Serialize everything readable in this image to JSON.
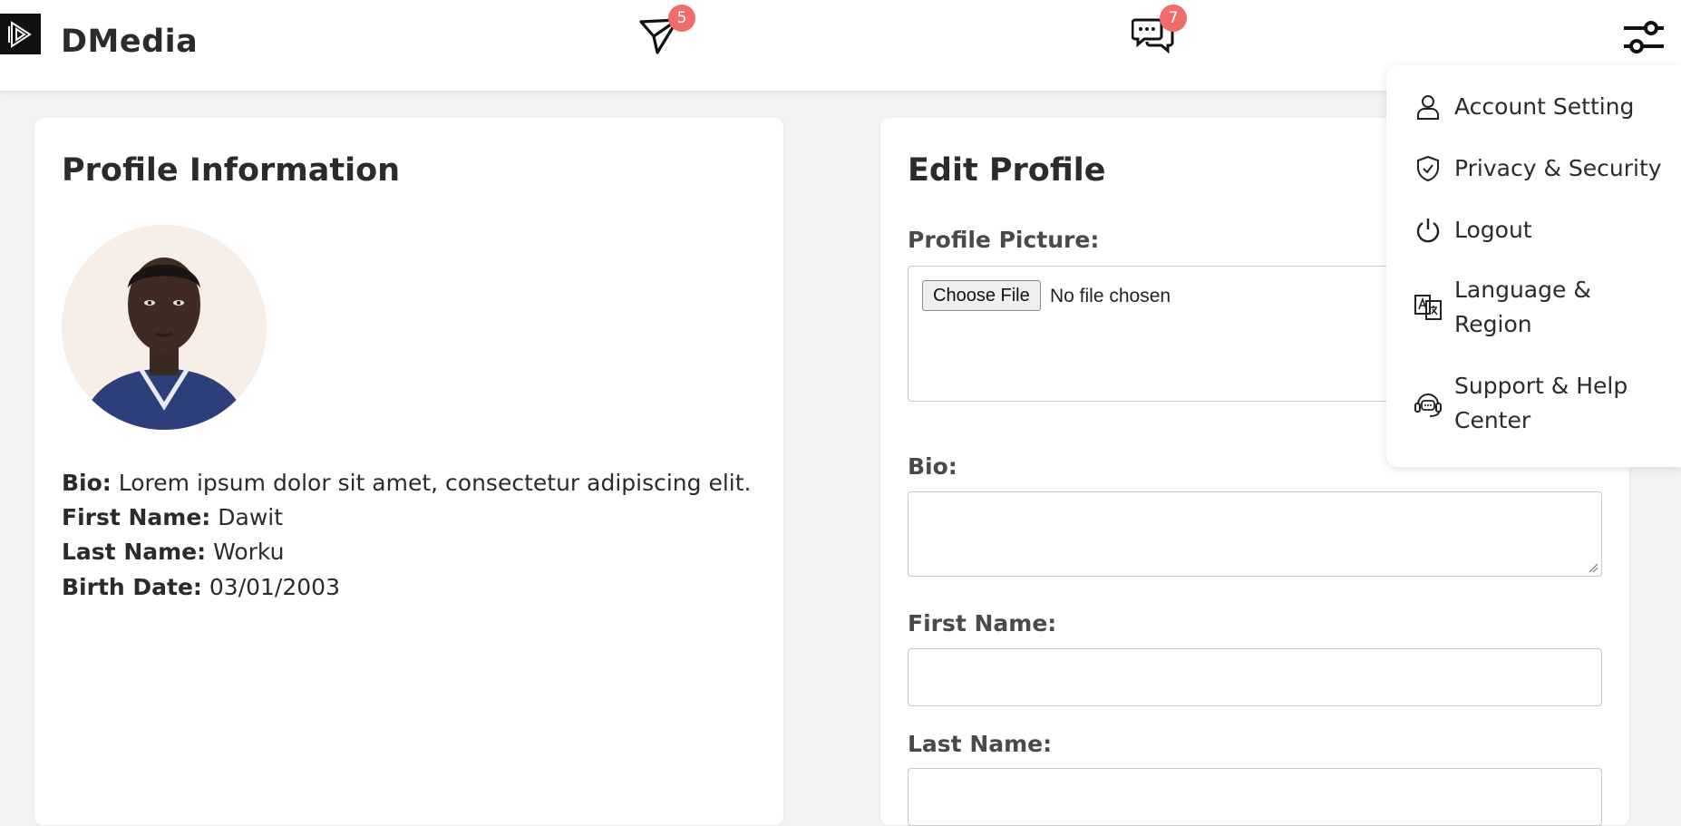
{
  "header": {
    "brand": "DMedia",
    "send_badge": "5",
    "chat_badge": "7"
  },
  "profile_info": {
    "title": "Profile Information",
    "bio_label": "Bio:",
    "bio_value": "Lorem ipsum dolor sit amet, consectetur adipiscing elit.",
    "first_label": "First Name:",
    "first_value": "Dawit",
    "last_label": "Last Name:",
    "last_value": "Worku",
    "birth_label": "Birth Date:",
    "birth_value": "03/01/2003"
  },
  "edit_profile": {
    "title": "Edit Profile",
    "picture_label": "Profile Picture:",
    "choose_file": "Choose File",
    "file_status": "No file chosen",
    "bio_label": "Bio:",
    "first_label": "First Name:",
    "last_label": "Last Name:"
  },
  "menu": {
    "items": [
      {
        "label": "Account Setting",
        "icon": "user-icon"
      },
      {
        "label": "Privacy & Security",
        "icon": "shield-icon"
      },
      {
        "label": "Logout",
        "icon": "power-icon"
      },
      {
        "label": "Language & Region",
        "icon": "translate-icon"
      },
      {
        "label": "Support & Help Center",
        "icon": "headset-icon"
      }
    ]
  },
  "colors": {
    "badge": "#f26b6b",
    "background": "#f3f3f3",
    "card": "#ffffff"
  }
}
